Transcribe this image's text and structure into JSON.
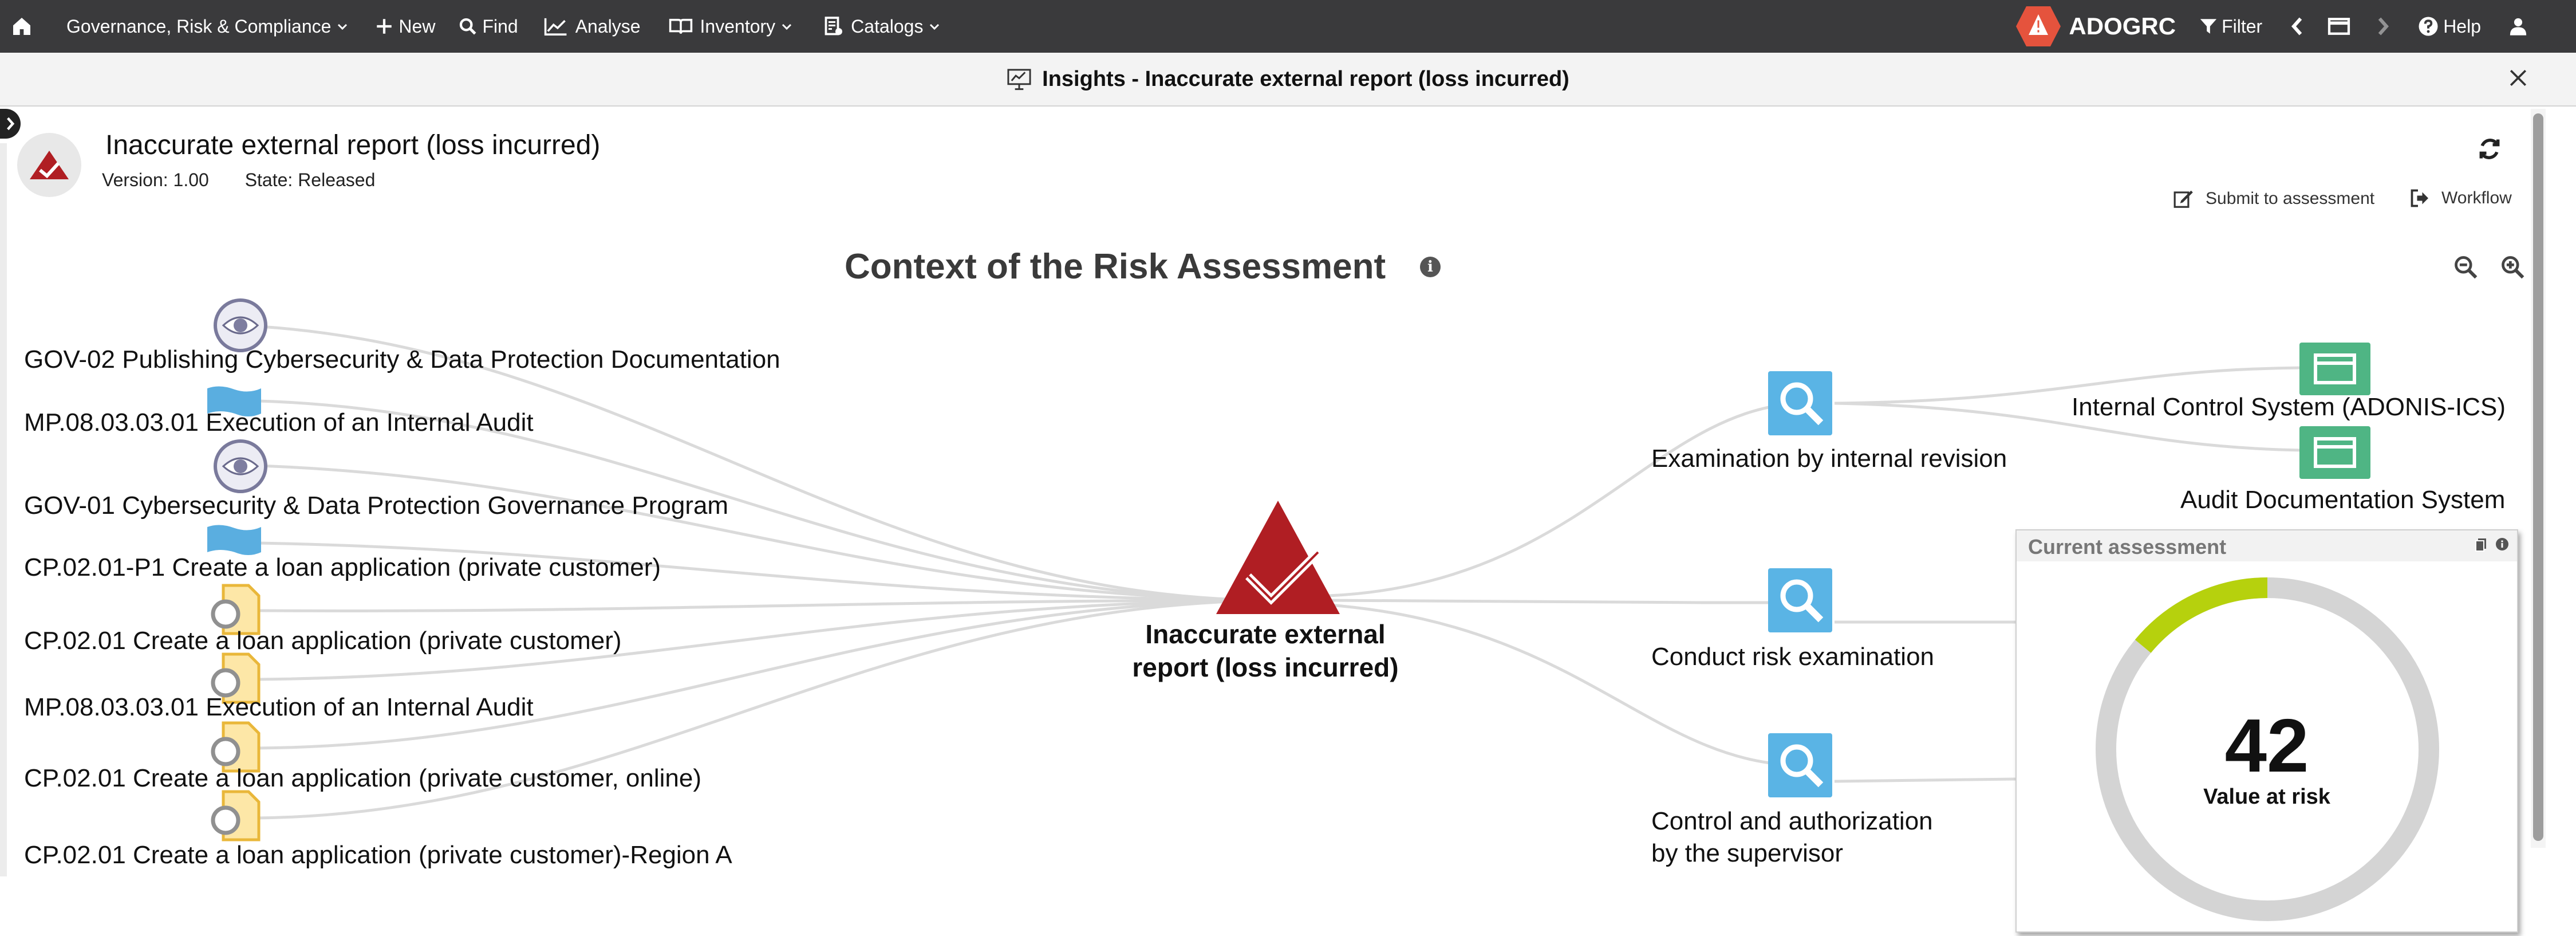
{
  "topbar": {
    "home_icon": "home-icon",
    "menu_grc": "Governance, Risk & Compliance",
    "new": "New",
    "find": "Find",
    "analyse": "Analyse",
    "inventory": "Inventory",
    "catalogs": "Catalogs",
    "brand": "ADOGRC",
    "filter": "Filter",
    "help": "Help",
    "colors": {
      "bar": "#3a3a3c",
      "brand_badge": "#e5533d"
    }
  },
  "subbar": {
    "title": "Insights - Inaccurate external report (loss incurred)"
  },
  "object": {
    "name": "Inaccurate external report (loss incurred)",
    "version": "Version: 1.00",
    "state": "State: Released",
    "actions": {
      "submit": "Submit to assessment",
      "workflow": "Workflow"
    }
  },
  "context": {
    "title": "Context of the Risk Assessment",
    "center_label": "Inaccurate external report (loss incurred)",
    "center_color": "#b01e23",
    "left_items": [
      {
        "label": "GOV-02 Publishing Cybersecurity & Data Protection Documentation",
        "icon": "eye-icon"
      },
      {
        "label": "MP.08.03.03.01 Execution of an Internal Audit",
        "icon": "process-flag-icon"
      },
      {
        "label": "GOV-01 Cybersecurity & Data Protection Governance Program",
        "icon": "eye-icon"
      },
      {
        "label": "CP.02.01-P1 Create a loan application (private customer)",
        "icon": "process-flag-icon"
      },
      {
        "label": "CP.02.01 Create a loan application (private customer)",
        "icon": "document-circle-icon"
      },
      {
        "label": "MP.08.03.03.01 Execution of an Internal Audit",
        "icon": "document-circle-icon"
      },
      {
        "label": "CP.02.01 Create a loan application (private customer, online)",
        "icon": "document-circle-icon"
      },
      {
        "label": "CP.02.01 Create a loan application (private customer)-Region A",
        "icon": "document-circle-icon"
      }
    ],
    "right_items": [
      {
        "label": "Examination by internal revision",
        "icon": "search-icon"
      },
      {
        "label": "Conduct risk examination",
        "icon": "search-icon"
      },
      {
        "label_line1": "Control and authorization",
        "label_line2": "by the supervisor",
        "icon": "search-icon"
      }
    ],
    "far_right_items": [
      {
        "label": "Internal Control System (ADONIS-ICS)",
        "icon": "application-icon"
      },
      {
        "label": "Audit Documentation System",
        "icon": "application-icon"
      }
    ]
  },
  "assessment_panel": {
    "title": "Current assessment",
    "value": "42",
    "caption": "Value at risk",
    "fraction": 0.14,
    "colors": {
      "fill": "#b6d10d",
      "track": "#d4d4d4"
    }
  }
}
